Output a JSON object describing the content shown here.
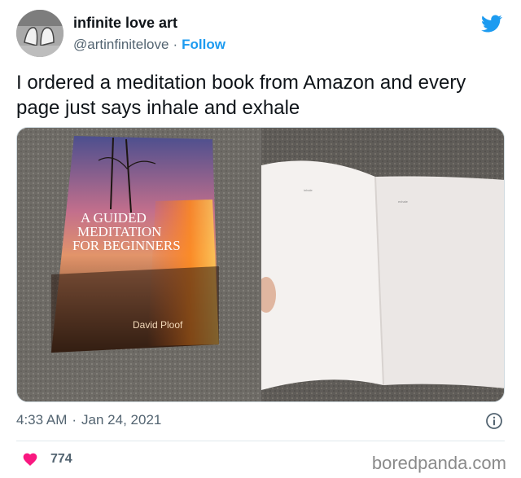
{
  "colors": {
    "accent": "#1d9bf0",
    "heart": "#f91880",
    "text": "#0f1419",
    "muted": "#536471"
  },
  "author": {
    "name": "infinite love art",
    "handle": "@artinfinitelove",
    "separator": "·",
    "follow_label": "Follow"
  },
  "tweet": {
    "text": "I ordered a meditation book from Amazon and every page just says inhale and exhale"
  },
  "media": {
    "book_cover": {
      "title_line1": "A GUIDED",
      "title_line2": "MEDITATION",
      "title_line3": "FOR BEGINNERS",
      "author": "David Ploof"
    },
    "open_book": {
      "left_page_word": "inhale",
      "right_page_word": "exhale"
    }
  },
  "meta": {
    "time": "4:33 AM",
    "separator": "·",
    "date": "Jan 24, 2021"
  },
  "engagement": {
    "likes": "774"
  },
  "watermark": "boredpanda.com",
  "icons": [
    "twitter-bird-icon",
    "info-icon",
    "heart-icon"
  ]
}
